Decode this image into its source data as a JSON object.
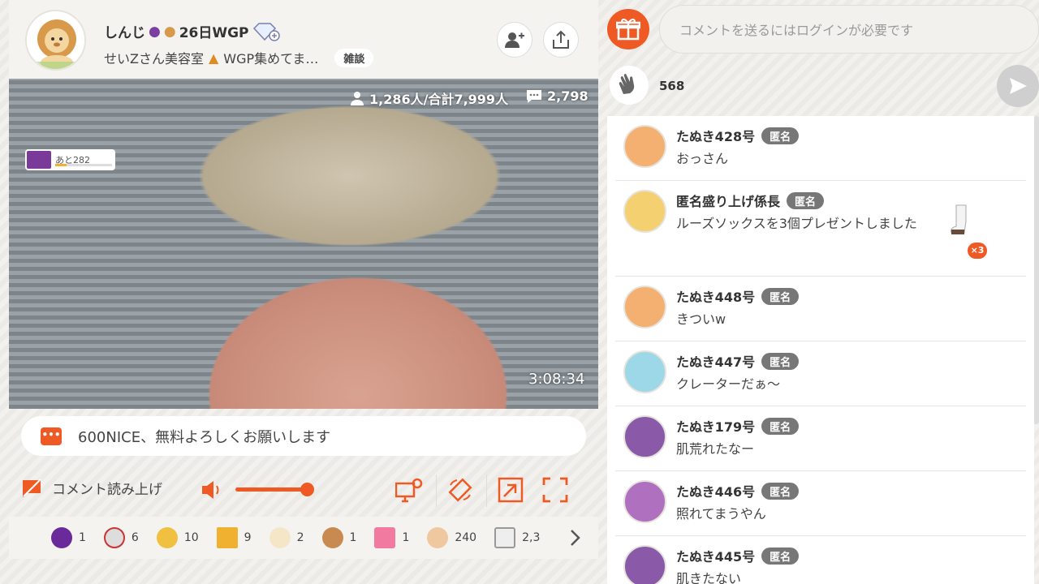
{
  "streamer": {
    "name": "しんじ",
    "badge_text": "26日WGP",
    "subtitle": "せいZさん美容室",
    "subtitle_tail": "WGP集めてま…",
    "category": "雑談"
  },
  "video": {
    "viewers": "1,286人/合計7,999人",
    "comments": "2,798",
    "elapsed": "3:08:34",
    "gift_remaining": "あと282",
    "gift_progress": 0.2
  },
  "notice": {
    "text": "600NICE、無料よろしくお願いします"
  },
  "controls": {
    "read_aloud": "コメント読み上げ"
  },
  "gift_counts": [
    "1",
    "6",
    "10",
    "9",
    "2",
    "1",
    "1",
    "240",
    "2,3"
  ],
  "comment_input": {
    "placeholder": "コメントを送るにはログインが必要です"
  },
  "clap_count": "568",
  "comments": [
    {
      "name": "たぬき428号",
      "tag": "匿名",
      "msg": "おっさん"
    },
    {
      "name": "匿名盛り上げ係長",
      "tag": "匿名",
      "msg": "ルーズソックスを3個プレゼントしました",
      "gift_count": "×3"
    },
    {
      "name": "たぬき448号",
      "tag": "匿名",
      "msg": "きついw"
    },
    {
      "name": "たぬき447号",
      "tag": "匿名",
      "msg": "クレーターだぁ～"
    },
    {
      "name": "たぬき179号",
      "tag": "匿名",
      "msg": "肌荒れたなー"
    },
    {
      "name": "たぬき446号",
      "tag": "匿名",
      "msg": "照れてまうやん"
    },
    {
      "name": "たぬき445号",
      "tag": "匿名",
      "msg": "肌きたない"
    }
  ],
  "colors": {
    "accent": "#ef5a24"
  }
}
